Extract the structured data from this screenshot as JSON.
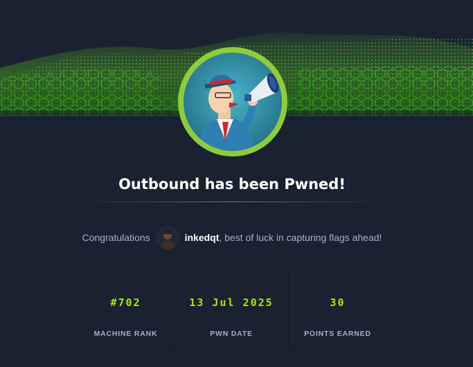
{
  "title": "Outbound has been Pwned!",
  "congrats": {
    "prefix": "Congratulations",
    "username": "inkedqt",
    "suffix": ", best of luck in capturing flags ahead!"
  },
  "stats": [
    {
      "value": "#702",
      "label": "MACHINE RANK"
    },
    {
      "value": "13 Jul 2025",
      "label": "PWN DATE"
    },
    {
      "value": "30",
      "label": "POINTS EARNED"
    }
  ],
  "colors": {
    "background": "#1a2130",
    "accent": "#9fef00",
    "badge_ring": "#8fcc3c",
    "muted_text": "#a4b1cd"
  },
  "icons": {
    "badge": "machine-avatar-megaphone-man",
    "user_avatar": "user-avatar"
  }
}
